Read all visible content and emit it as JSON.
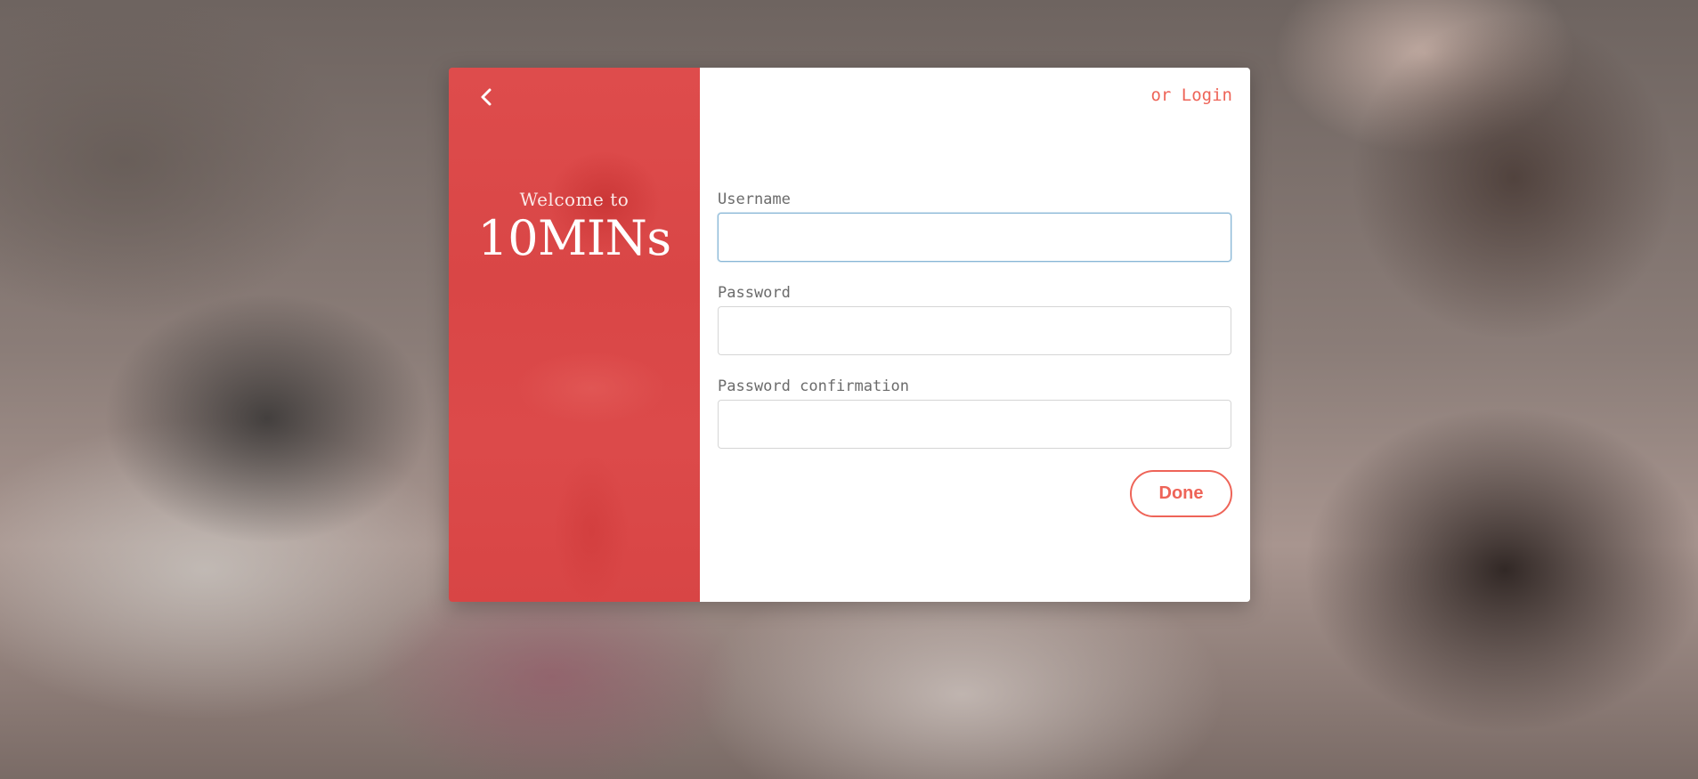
{
  "left_panel": {
    "welcome_text": "Welcome to",
    "brand_name": "10MINs",
    "back_icon": "chevron-left-icon"
  },
  "header": {
    "login_link": "or Login"
  },
  "form": {
    "username": {
      "label": "Username",
      "value": "",
      "placeholder": ""
    },
    "password": {
      "label": "Password",
      "value": "",
      "placeholder": ""
    },
    "password_confirmation": {
      "label": "Password confirmation",
      "value": "",
      "placeholder": ""
    }
  },
  "actions": {
    "done_label": "Done"
  },
  "colors": {
    "accent": "#ee6458",
    "panel_red": "#dc4a4a",
    "focus_border": "#88b6d6"
  }
}
